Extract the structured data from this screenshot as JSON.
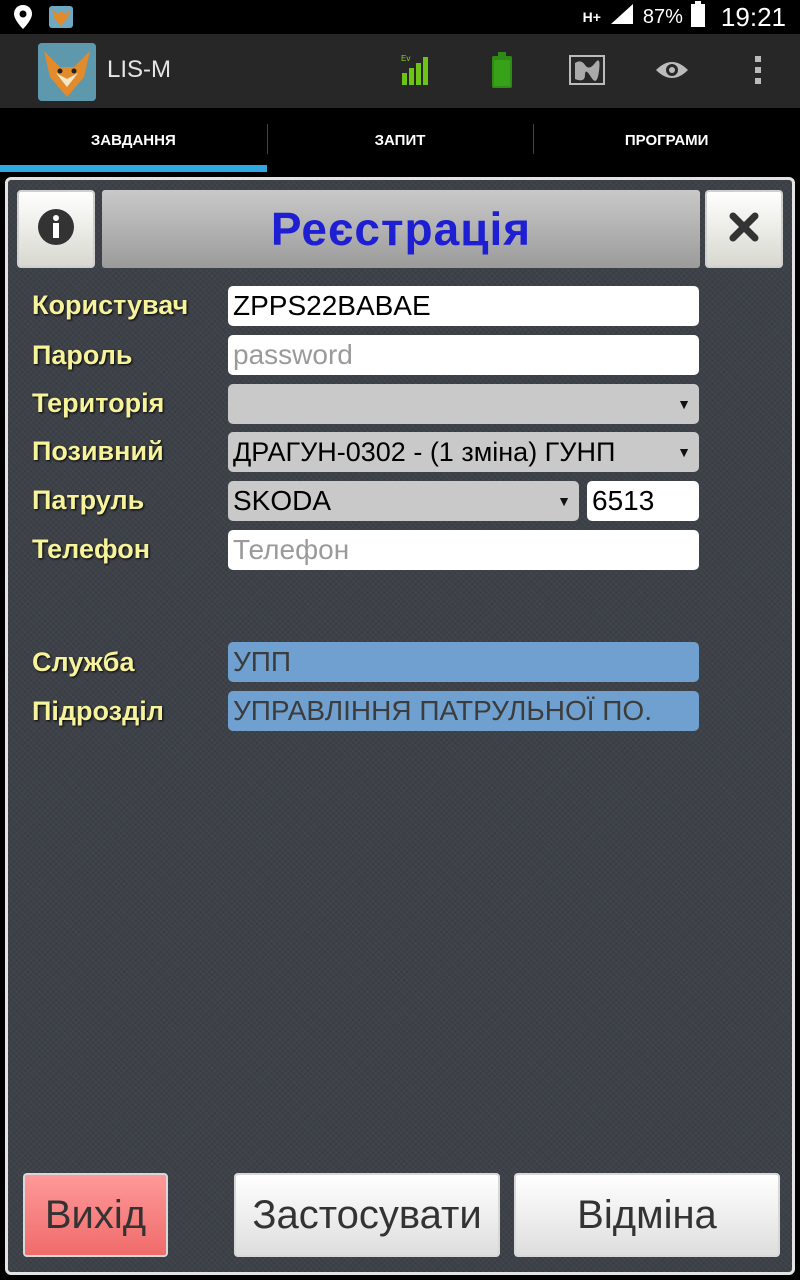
{
  "status_bar": {
    "network": "H+",
    "battery": "87%",
    "time": "19:21",
    "icons": [
      "location-pin-icon",
      "app-notification-icon",
      "signal-icon",
      "battery-icon"
    ]
  },
  "action_bar": {
    "title": "LIS-M",
    "signal_badge": "Ev",
    "icons": [
      "app-logo-icon",
      "signal-strength-icon",
      "battery-level-icon",
      "map-icon",
      "eye-icon",
      "overflow-menu-icon"
    ]
  },
  "tabs": [
    {
      "label": "ЗАВДАННЯ",
      "active": true
    },
    {
      "label": "ЗАПИТ",
      "active": false
    },
    {
      "label": "ПРОГРАМИ",
      "active": false
    }
  ],
  "dialog": {
    "title": "Реєстрація",
    "info_icon": "info-icon",
    "close_icon": "close-icon"
  },
  "form": {
    "user": {
      "label": "Користувач",
      "value": "ZPPS22BABAE"
    },
    "password": {
      "label": "Пароль",
      "placeholder": "password"
    },
    "territory": {
      "label": "Територія",
      "value": ""
    },
    "callsign": {
      "label": "Позивний",
      "value": "ДРАГУН-0302 - (1 зміна) ГУНП"
    },
    "patrol": {
      "label": "Патруль",
      "value": "SKODA",
      "number": "6513"
    },
    "phone": {
      "label": "Телефон",
      "placeholder": "Телефон"
    },
    "service": {
      "label": "Служба",
      "value": "УПП"
    },
    "division": {
      "label": "Підрозділ",
      "value": "УПРАВЛІННЯ ПАТРУЛЬНОЇ ПО."
    }
  },
  "buttons": {
    "exit": "Вихід",
    "apply": "Застосувати",
    "cancel": "Відміна"
  },
  "colors": {
    "title_text": "#1e1ed2",
    "label_text": "#f7f39a",
    "tab_indicator": "#2fa7e0",
    "exit_button": "#f07070",
    "readonly_field": "#6fa0cf"
  }
}
